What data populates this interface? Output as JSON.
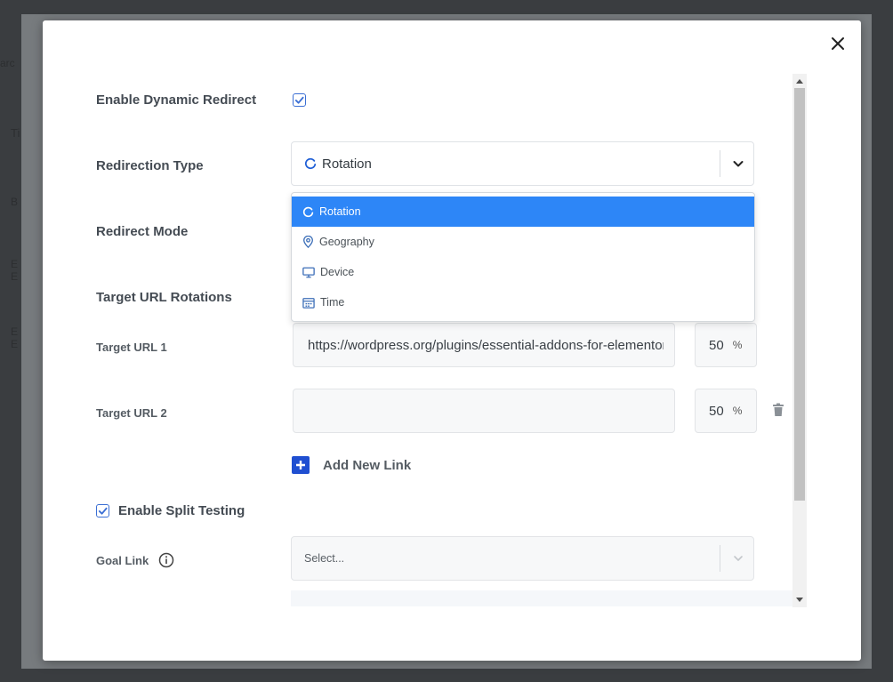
{
  "background": {
    "fragments": [
      "arc",
      "Ti",
      "B",
      "E",
      "E",
      "E",
      "E"
    ]
  },
  "modal": {
    "close_icon": "close-icon",
    "enable_dynamic_redirect": {
      "label": "Enable Dynamic Redirect",
      "checked": true
    },
    "redirection_type": {
      "label": "Redirection Type",
      "selected": "Rotation",
      "options": [
        {
          "label": "Rotation",
          "icon": "rotation-icon",
          "active": true
        },
        {
          "label": "Geography",
          "icon": "location-pin-icon",
          "active": false
        },
        {
          "label": "Device",
          "icon": "monitor-icon",
          "active": false
        },
        {
          "label": "Time",
          "icon": "calendar-icon",
          "active": false
        }
      ]
    },
    "redirect_mode": {
      "label": "Redirect Mode"
    },
    "target_url_rotations": {
      "label": "Target URL Rotations"
    },
    "target_urls": [
      {
        "label": "Target URL 1",
        "value": "https://wordpress.org/plugins/essential-addons-for-elementor-lite/",
        "percent": "50",
        "unit": "%"
      },
      {
        "label": "Target URL 2",
        "value": "",
        "percent": "50",
        "unit": "%"
      }
    ],
    "add_new_link": "Add New Link",
    "enable_split_testing": {
      "label": "Enable Split Testing",
      "checked": true
    },
    "goal_link": {
      "label": "Goal Link",
      "placeholder": "Select..."
    }
  },
  "colors": {
    "accent": "#2d86f7",
    "checkbox": "#3b6fd4",
    "add_button": "#1f4fd1"
  }
}
